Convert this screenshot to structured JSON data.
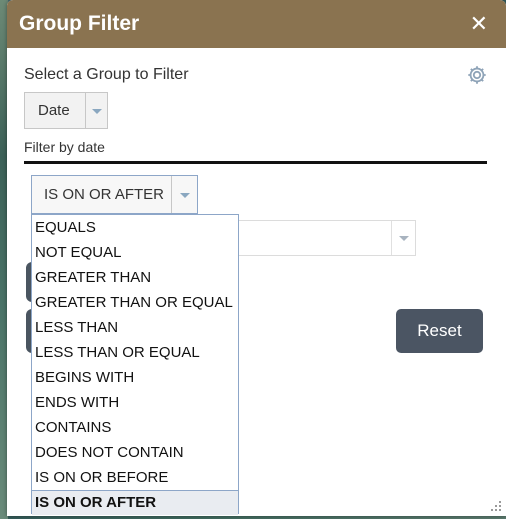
{
  "panel": {
    "title": "Group Filter",
    "close_glyph": "✕"
  },
  "group": {
    "label": "Select a Group to Filter",
    "selected": "Date"
  },
  "filter": {
    "label": "Filter by date"
  },
  "operator": {
    "selected": "IS ON OR AFTER",
    "options": [
      "EQUALS",
      "NOT EQUAL",
      "GREATER THAN",
      "GREATER THAN OR EQUAL",
      "LESS THAN",
      "LESS THAN OR EQUAL",
      "BEGINS WITH",
      "ENDS WITH",
      "CONTAINS",
      "DOES NOT CONTAIN",
      "IS ON OR BEFORE",
      "IS ON OR AFTER"
    ],
    "highlighted_index": 11
  },
  "actions": {
    "reset_label": "Reset"
  },
  "icons": {
    "settings": "gear-icon",
    "close": "close-icon",
    "dropdown": "chevron-down-icon",
    "resize": "resize-grip-icon"
  },
  "colors": {
    "header": "#8a7350",
    "button": "#4b5563",
    "focus_border": "#8da6c8",
    "arrow": "#8aa7c0"
  }
}
